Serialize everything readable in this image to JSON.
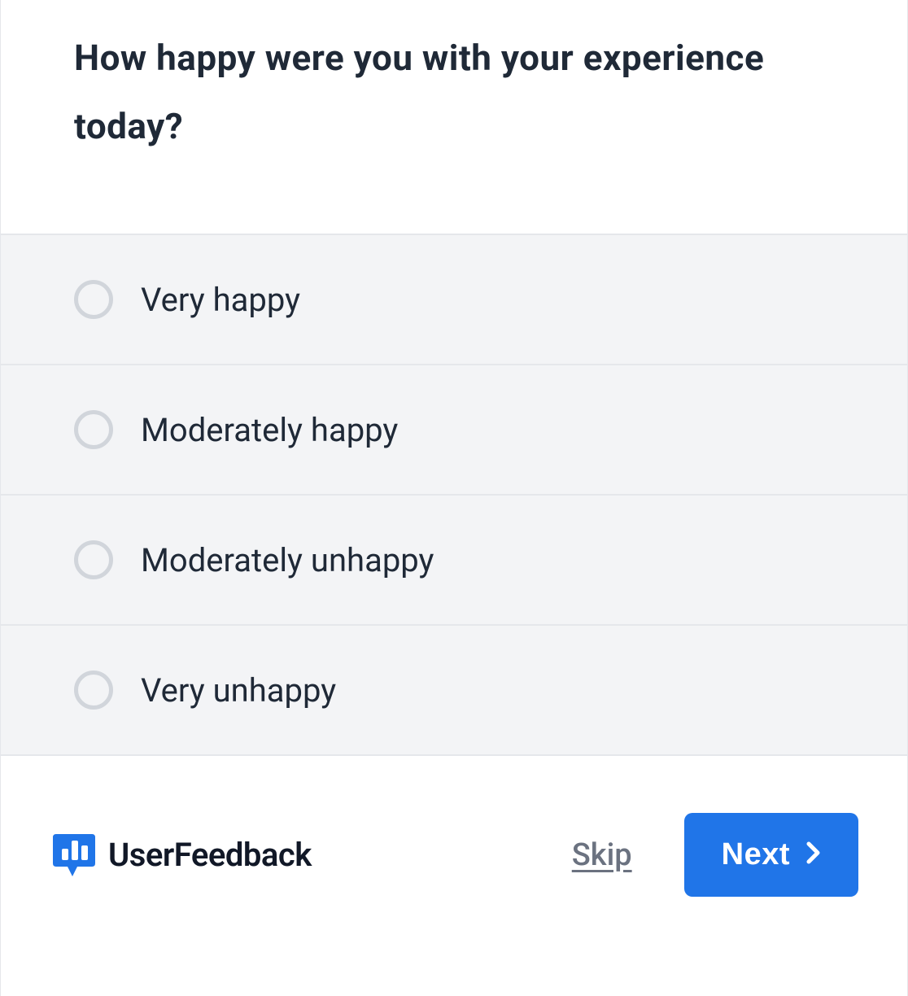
{
  "question": {
    "title": "How happy were you with your experience today?"
  },
  "options": [
    {
      "label": "Very happy"
    },
    {
      "label": "Moderately happy"
    },
    {
      "label": "Moderately unhappy"
    },
    {
      "label": "Very unhappy"
    }
  ],
  "footer": {
    "brand": "UserFeedback",
    "skip_label": "Skip",
    "next_label": "Next"
  },
  "colors": {
    "primary": "#2075e8",
    "text": "#1f2937",
    "muted": "#6b7280",
    "option_bg": "#f3f4f6",
    "border": "#e5e7eb"
  }
}
